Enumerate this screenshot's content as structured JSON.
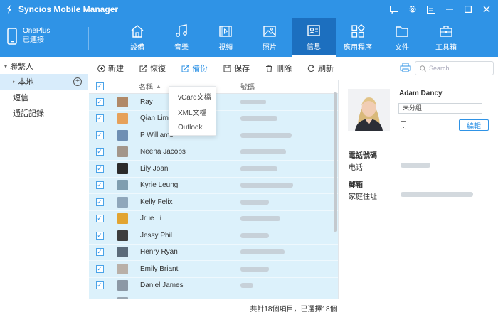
{
  "app": {
    "title": "Syncios Mobile Manager",
    "brand_color": "#2f93e6"
  },
  "device": {
    "name": "OnePlus",
    "status": "已連接"
  },
  "nav": {
    "tabs": [
      {
        "label": "設備",
        "icon": "home-icon"
      },
      {
        "label": "音樂",
        "icon": "music-icon"
      },
      {
        "label": "視頻",
        "icon": "video-icon"
      },
      {
        "label": "照片",
        "icon": "photo-icon"
      },
      {
        "label": "信息",
        "icon": "contacts-icon",
        "active": true
      },
      {
        "label": "應用程序",
        "icon": "apps-icon"
      },
      {
        "label": "文件",
        "icon": "folder-icon"
      },
      {
        "label": "工具箱",
        "icon": "toolbox-icon"
      }
    ]
  },
  "sidebar": {
    "group": "聯繫人",
    "local": "本地",
    "items": [
      "短信",
      "通話記錄"
    ]
  },
  "toolbar": {
    "new": "新建",
    "restore": "恢復",
    "backup": "備份",
    "save": "保存",
    "delete": "刪除",
    "refresh": "刷新",
    "search_placeholder": "Search"
  },
  "backup_menu": [
    "vCard文檔",
    "XML文檔",
    "Outlook"
  ],
  "table": {
    "headers": {
      "name": "名稱",
      "phone": "號碼"
    },
    "rows": [
      {
        "name": "Ray"
      },
      {
        "name": "Qian Lim"
      },
      {
        "name": "P Williams"
      },
      {
        "name": "Neena Jacobs"
      },
      {
        "name": "Lily Joan"
      },
      {
        "name": "Kyrie Leung"
      },
      {
        "name": "Kelly Felix"
      },
      {
        "name": "Jrue Li"
      },
      {
        "name": "Jessy Phil"
      },
      {
        "name": "Henry Ryan"
      },
      {
        "name": "Emily Briant"
      },
      {
        "name": "Daniel James"
      },
      {
        "name": ""
      }
    ]
  },
  "details": {
    "name": "Adam Dancy",
    "group": "未分組",
    "edit": "編輯",
    "phone_section": "電話號碼",
    "phone_label": "电话",
    "email_section": "郵箱",
    "address_label": "家庭住址"
  },
  "footer": {
    "status": "共計18個項目，已選擇18個"
  }
}
